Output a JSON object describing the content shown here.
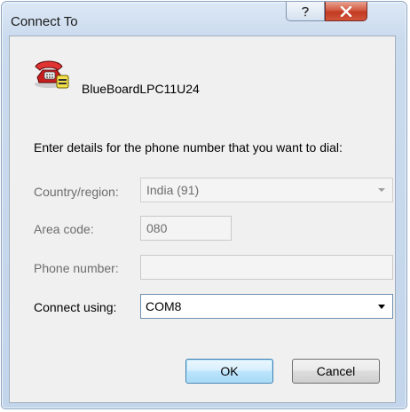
{
  "dialog": {
    "title": "Connect To"
  },
  "connection": {
    "name": "BlueBoardLPC11U24",
    "icon": "telephone-icon"
  },
  "instruction": "Enter details for the phone number that you want to dial:",
  "form": {
    "country_label": "Country/region:",
    "country_value": "India (91)",
    "area_label": "Area code:",
    "area_value": "080",
    "phone_label": "Phone number:",
    "phone_value": "",
    "connect_label": "Connect using:",
    "connect_value": "COM8"
  },
  "buttons": {
    "ok": "OK",
    "cancel": "Cancel"
  },
  "titlebar": {
    "help_icon": "help-icon",
    "close_icon": "close-icon"
  }
}
